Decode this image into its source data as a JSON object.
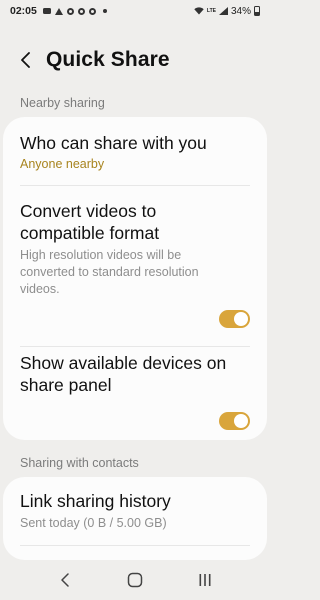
{
  "status_bar": {
    "time": "02:05",
    "battery": "34%",
    "network": "LTE",
    "icons": [
      "message-icon",
      "alert-icon",
      "settings-icon",
      "settings-icon",
      "settings-icon",
      "dot-icon",
      "wifi-icon",
      "signal-icon",
      "battery-icon"
    ]
  },
  "header": {
    "back_icon": "back-arrow-icon",
    "title": "Quick Share"
  },
  "sections": {
    "nearby_sharing": "Nearby sharing",
    "sharing_with_contacts": "Sharing with contacts"
  },
  "settings": {
    "who_can_share": {
      "title": "Who can share with you",
      "value": "Anyone nearby"
    },
    "convert_videos": {
      "title_line1": "Convert videos to",
      "title_line2": "compatible format",
      "desc_line1": "High resolution videos will be",
      "desc_line2": "converted to standard resolution",
      "desc_line3": "videos.",
      "enabled": true
    },
    "show_devices": {
      "title_line1": "Show available devices on",
      "title_line2": "share panel",
      "enabled": true
    },
    "link_sharing_history": {
      "title": "Link sharing history",
      "value": "Sent today (0 B / 5.00 GB)"
    }
  },
  "nav_bar": {
    "icons": [
      "recent-apps-back-icon",
      "home-icon",
      "recent-apps-icon"
    ]
  },
  "colors": {
    "accent": "#d9a53b",
    "value_text": "#a8841e",
    "background": "#efeeec",
    "card": "#fcfcfc"
  }
}
